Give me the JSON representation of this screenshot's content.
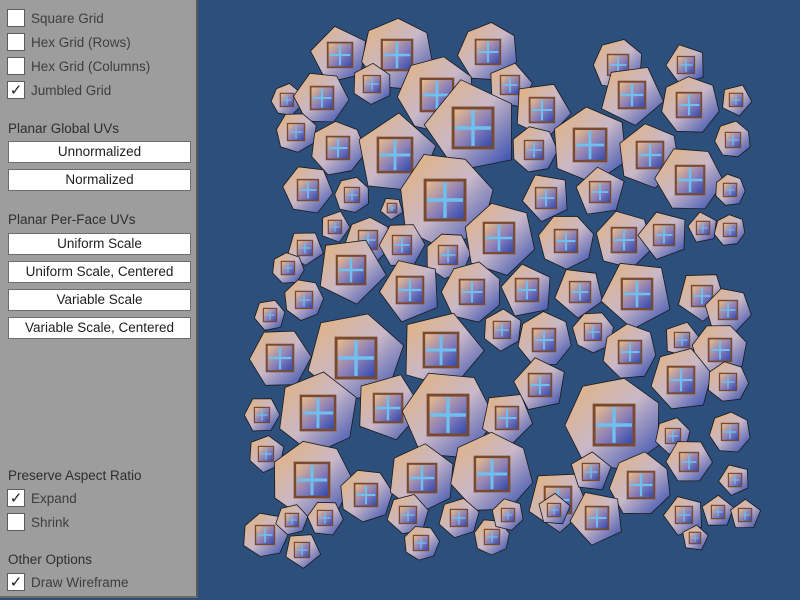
{
  "grid_options": [
    {
      "label": "Square Grid",
      "checked": false
    },
    {
      "label": "Hex Grid (Rows)",
      "checked": false
    },
    {
      "label": "Hex Grid (Columns)",
      "checked": false
    },
    {
      "label": "Jumbled Grid",
      "checked": true
    }
  ],
  "planar_global": {
    "heading": "Planar Global UVs",
    "buttons": [
      "Unnormalized",
      "Normalized"
    ]
  },
  "planar_per_face": {
    "heading": "Planar Per-Face UVs",
    "buttons": [
      "Uniform Scale",
      "Uniform Scale, Centered",
      "Variable Scale",
      "Variable Scale, Centered"
    ]
  },
  "preserve_aspect": {
    "heading": "Preserve Aspect Ratio",
    "options": [
      {
        "label": "Expand",
        "checked": true
      },
      {
        "label": "Shrink",
        "checked": false
      }
    ]
  },
  "other_options": {
    "heading": "Other Options",
    "options": [
      {
        "label": "Draw Wireframe",
        "checked": true
      }
    ]
  },
  "check_glyph": "✓",
  "colors": {
    "background": "#2d4f7b",
    "panel": "#9d9d9d",
    "cell_orange": "#e6b276",
    "cell_blue": "#2a45ae",
    "square_frame": "#7a4a2e",
    "cross": "#6ec0f0"
  }
}
